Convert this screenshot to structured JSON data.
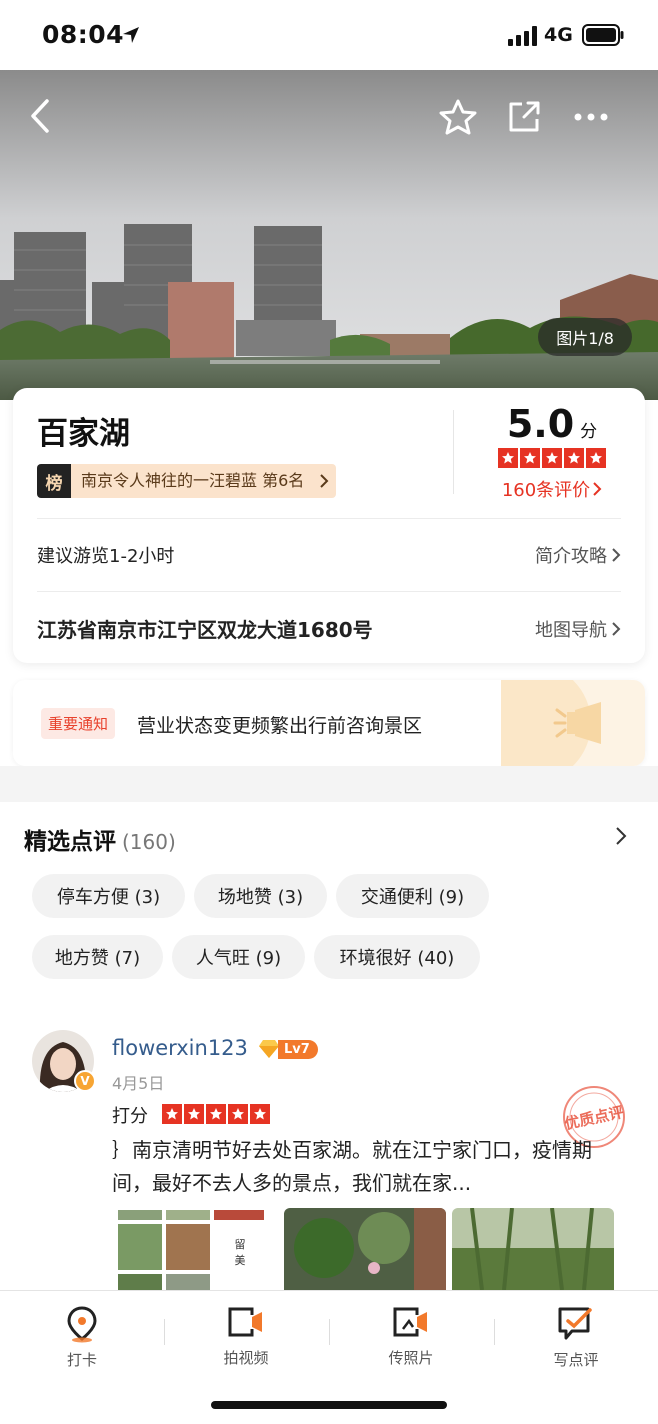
{
  "status_bar": {
    "time": "08:04",
    "network": "4G"
  },
  "hero": {
    "photo_counter": "图片1/8"
  },
  "poi": {
    "name": "百家湖",
    "rank_tag": "榜",
    "rank_text": "南京令人神往的一汪碧蓝 第6名",
    "score": "5.0",
    "score_unit": "分",
    "rating_stars": 5,
    "review_count_link": "160条评价",
    "suggested_visit": "建议游览1-2小时",
    "intro_link": "简介攻略",
    "address": "江苏省南京市江宁区双龙大道1680号",
    "map_link": "地图导航"
  },
  "notice": {
    "tag": "重要通知",
    "text": "营业状态变更频繁出行前咨询景区"
  },
  "reviews": {
    "title": "精选点评",
    "count": "(160)",
    "chips": [
      "停车方便 (3)",
      "场地赞 (3)",
      "交通便利 (9)",
      "地方赞 (7)",
      "人气旺 (9)",
      "环境很好 (40)"
    ],
    "items": [
      {
        "user": "flowerxin123",
        "level": "Lv7",
        "verified_badge": "V",
        "date": "4月5日",
        "rate_label": "打分",
        "stars": 5,
        "stamp": "优质点评",
        "text": "｝南京清明节好去处百家湖。就在江宁家门口，疫情期间，最好不去人多的景点，我们就在家..."
      }
    ]
  },
  "bottom_bar": {
    "tabs": [
      {
        "label": "打卡",
        "icon": "location-pin-icon"
      },
      {
        "label": "拍视频",
        "icon": "video-camera-icon"
      },
      {
        "label": "传照片",
        "icon": "upload-photo-icon"
      },
      {
        "label": "写点评",
        "icon": "write-review-icon"
      }
    ]
  },
  "colors": {
    "accent_red": "#e63323",
    "level_orange": "#f2792b",
    "username_blue": "#355c8c"
  }
}
